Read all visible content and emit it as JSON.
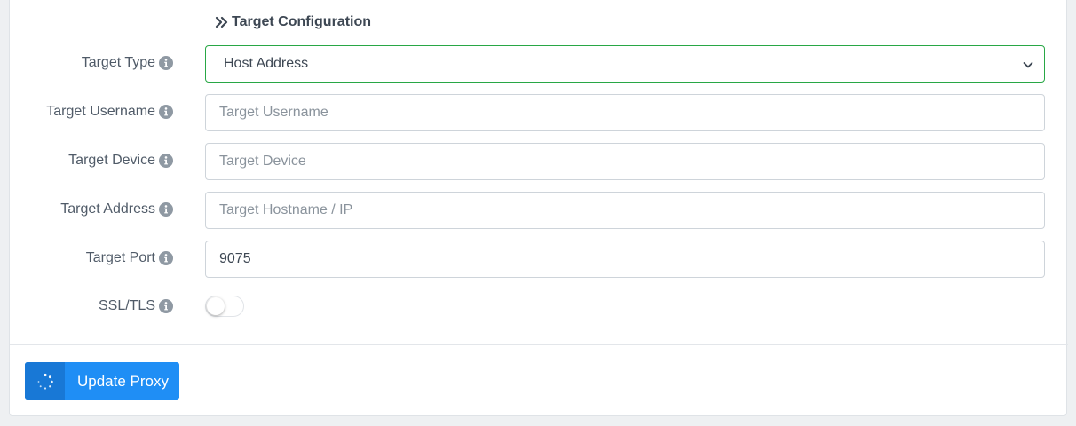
{
  "section": {
    "title": "Target Configuration",
    "icon": "double-chevron-right-icon"
  },
  "fields": {
    "target_type": {
      "label": "Target Type",
      "selected": "Host Address"
    },
    "target_username": {
      "label": "Target Username",
      "value": "",
      "placeholder": "Target Username"
    },
    "target_device": {
      "label": "Target Device",
      "value": "",
      "placeholder": "Target Device"
    },
    "target_address": {
      "label": "Target Address",
      "value": "",
      "placeholder": "Target Hostname / IP"
    },
    "target_port": {
      "label": "Target Port",
      "value": "9075",
      "placeholder": ""
    },
    "ssl_tls": {
      "label": "SSL/TLS",
      "enabled": false
    }
  },
  "actions": {
    "update_label": "Update Proxy",
    "update_icon": "spinner-icon"
  },
  "colors": {
    "select_border": "#28a745",
    "button_primary": "#1f8ef5",
    "button_icon_bg": "#1878d6",
    "info_icon": "#8f99a3"
  }
}
